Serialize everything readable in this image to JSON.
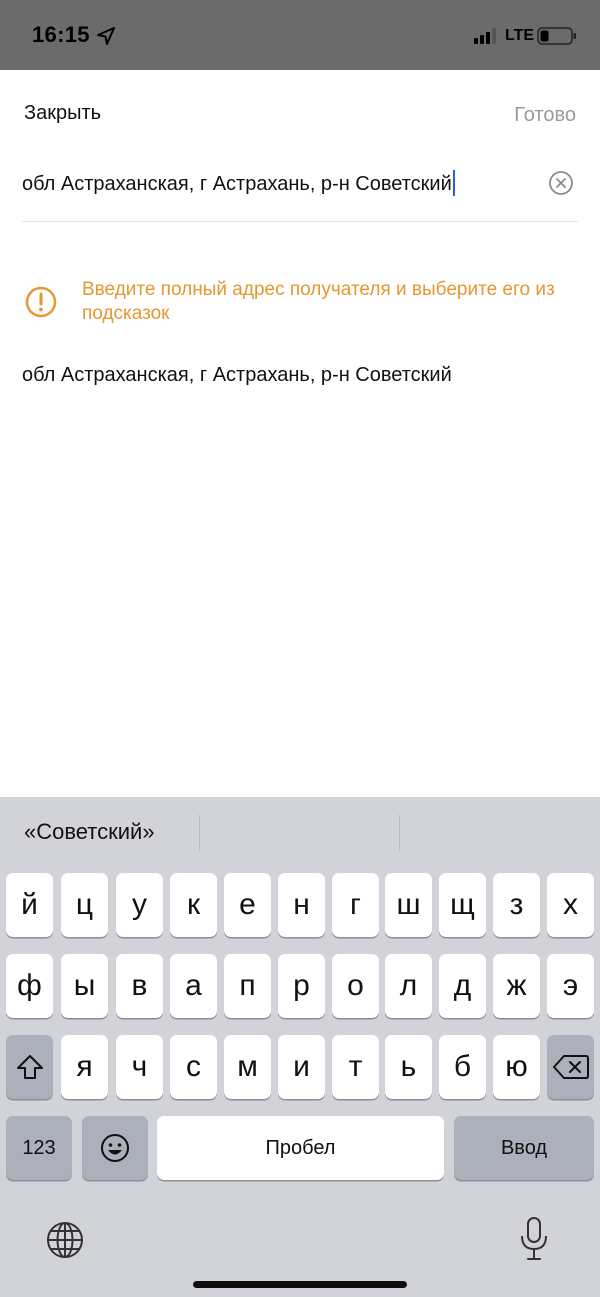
{
  "status_bar": {
    "time": "16:15",
    "network": "LTE",
    "icons": [
      "location-arrow-icon",
      "signal-icon",
      "battery-icon"
    ]
  },
  "header": {
    "close_label": "Закрыть",
    "done_label": "Готово"
  },
  "address_input": {
    "value": "обл Астраханская, г Астрахань, р-н Советский",
    "clear_icon": "clear-circle-icon"
  },
  "warning": {
    "icon": "exclamation-circle-icon",
    "text": "Введите полный адрес получателя и выберите его из подсказок",
    "color": "#e8962f"
  },
  "suggestions": [
    "обл Астраханская, г Астрахань, р-н Советский"
  ],
  "keyboard": {
    "predictions": [
      "«Советский»",
      "",
      ""
    ],
    "row1": [
      "й",
      "ц",
      "у",
      "к",
      "е",
      "н",
      "г",
      "ш",
      "щ",
      "з",
      "х"
    ],
    "row2": [
      "ф",
      "ы",
      "в",
      "а",
      "п",
      "р",
      "о",
      "л",
      "д",
      "ж",
      "э"
    ],
    "row3": [
      "я",
      "ч",
      "с",
      "м",
      "и",
      "т",
      "ь",
      "б",
      "ю"
    ],
    "numbers_label": "123",
    "space_label": "Пробел",
    "enter_label": "Ввод",
    "icons": [
      "shift-icon",
      "backspace-icon",
      "emoji-icon",
      "globe-icon",
      "microphone-icon"
    ]
  }
}
